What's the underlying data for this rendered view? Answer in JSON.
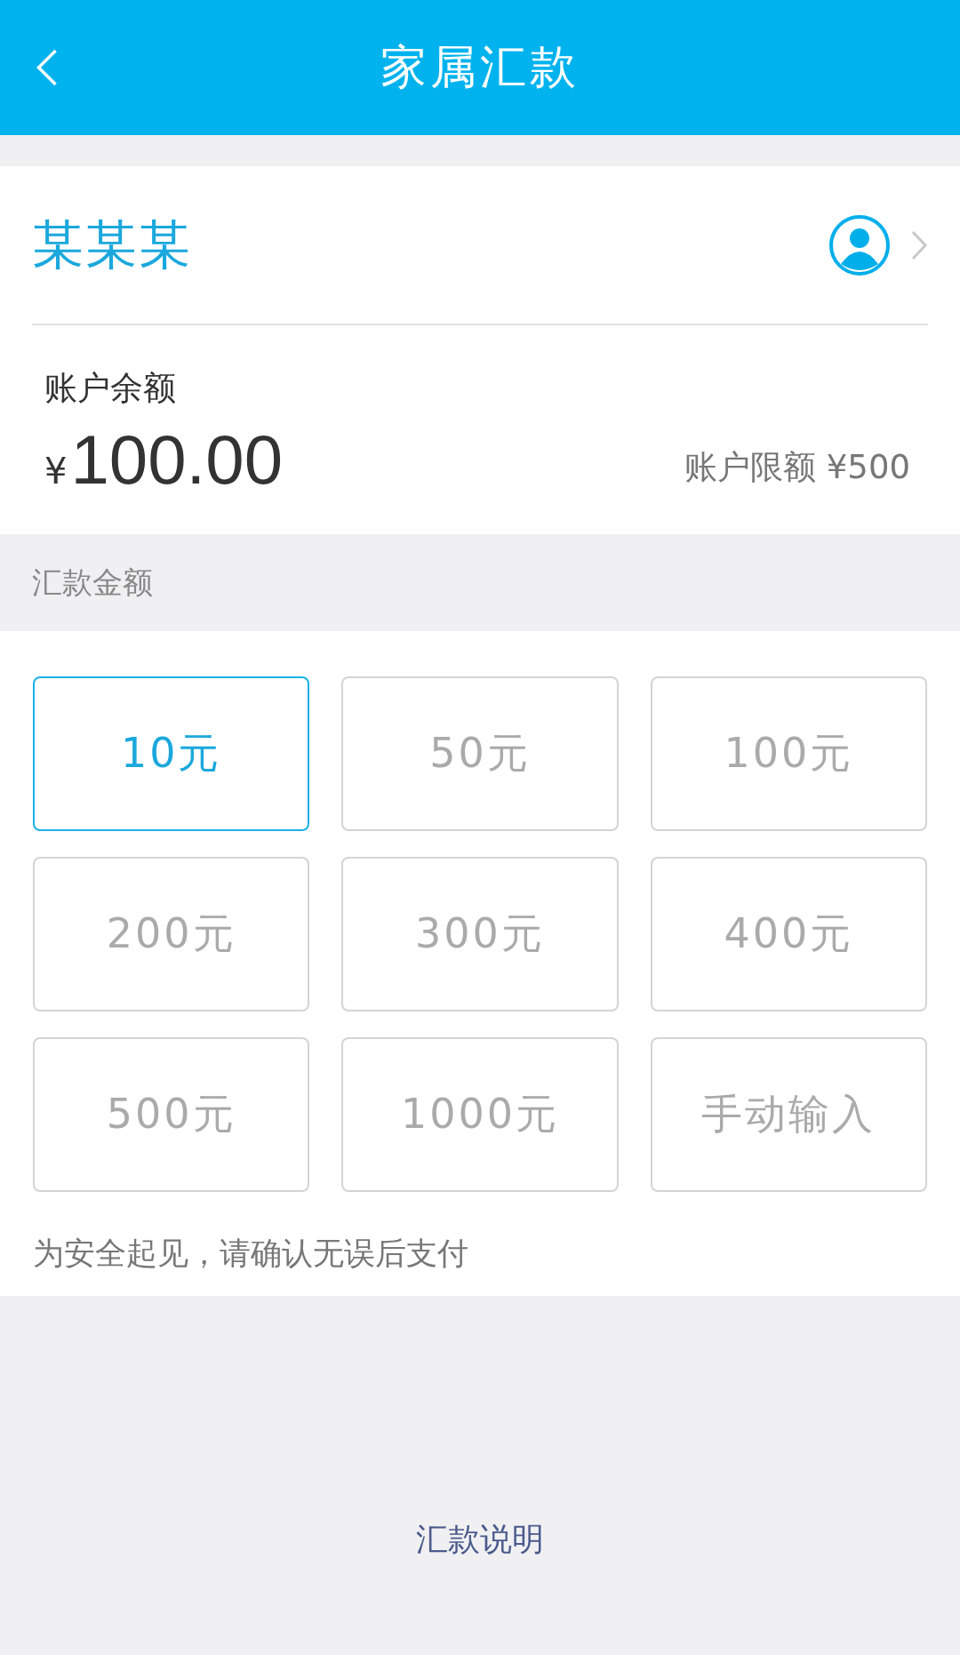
{
  "header": {
    "title": "家属汇款"
  },
  "recipient": {
    "name": "某某某"
  },
  "balance": {
    "label": "账户余额",
    "currency": "¥",
    "amount": "100.00",
    "limit": "账户限额 ¥500"
  },
  "amount_section": {
    "label": "汇款金额"
  },
  "amounts": [
    {
      "label": "10元",
      "selected": true
    },
    {
      "label": "50元",
      "selected": false
    },
    {
      "label": "100元",
      "selected": false
    },
    {
      "label": "200元",
      "selected": false
    },
    {
      "label": "300元",
      "selected": false
    },
    {
      "label": "400元",
      "selected": false
    },
    {
      "label": "500元",
      "selected": false
    },
    {
      "label": "1000元",
      "selected": false
    },
    {
      "label": "手动输入",
      "selected": false
    }
  ],
  "notice": "为安全起见，请确认无误后支付",
  "footer_link": "汇款说明"
}
